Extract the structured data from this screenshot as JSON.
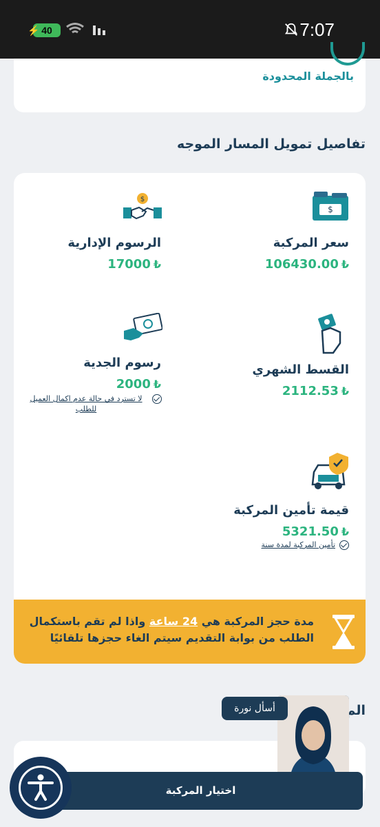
{
  "status_bar": {
    "time": "7:07",
    "battery": "40"
  },
  "top_card": {
    "title": "بالجملة المحدودة"
  },
  "section_title": "تفاصيل تمويل المسار الموجه",
  "currency_symbol": "₺",
  "details": {
    "vehicle_price": {
      "label": "سعر المركبة",
      "value": "106430.00",
      "icon": "cash-stack-icon"
    },
    "admin_fees": {
      "label": "الرسوم الإدارية",
      "value": "17000",
      "icon": "handshake-icon"
    },
    "monthly_installment": {
      "label": "القسط الشهري",
      "value": "2112.53",
      "icon": "hand-money-icon"
    },
    "seriousness_fees": {
      "label": "رسوم الجدية",
      "value": "2000",
      "note": "لا تسترد في حالة عدم اكمال العميل للطلب",
      "icon": "hand-bill-icon"
    },
    "insurance_value": {
      "label": "قيمة تأمين المركبة",
      "value": "5321.50",
      "note": "تأمين المركبة لمدة سنة",
      "icon": "car-shield-icon"
    }
  },
  "banner": {
    "line1_pre": "مدة حجز المركبة هي",
    "highlight": "24 ساعة",
    "line1_post": "واذا لم تقم باستكمال",
    "line2": "الطلب من بوابة التقديم سيتم الغاء حجزها تلقائيًا",
    "icon": "hourglass-icon"
  },
  "lower_title": "الم... ...ة",
  "assistant": {
    "label": "أسأل نورة"
  },
  "cta": {
    "label": "اختيار المركبة"
  },
  "colors": {
    "navy": "#1d3c56",
    "green": "#2cb47f",
    "teal": "#1b8f9b",
    "banner": "#f2b131"
  }
}
